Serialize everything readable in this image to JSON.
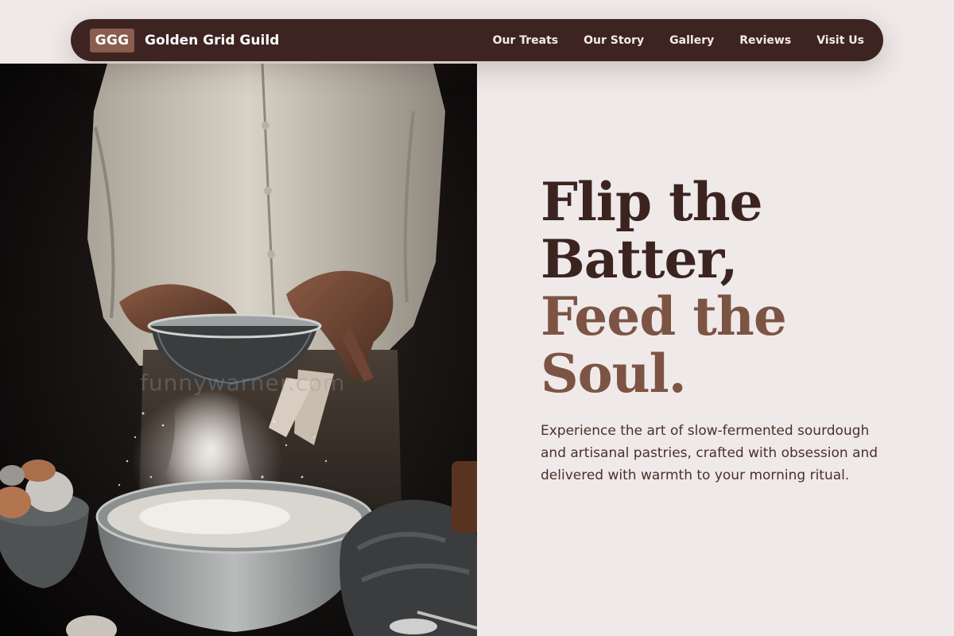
{
  "brand": {
    "badge": "GGG",
    "name": "Golden Grid Guild"
  },
  "nav": {
    "links": [
      "Our Treats",
      "Our Story",
      "Gallery",
      "Reviews",
      "Visit Us"
    ]
  },
  "hero": {
    "headline_line1": "Flip the",
    "headline_line2": "Batter,",
    "headline_line3": "Feed the",
    "headline_line4": "Soul.",
    "subtitle": "Experience the art of slow-fermented sourdough and artisanal pastries, crafted with obsession and delivered with warmth to your morning ritual.",
    "image_watermark": "funnywarner.com"
  },
  "colors": {
    "nav_background": "#3d2420",
    "badge_background": "#8a5d4e",
    "headline_dark": "#3b2420",
    "headline_accent": "#7d5444",
    "page_background": "#efeae9"
  }
}
